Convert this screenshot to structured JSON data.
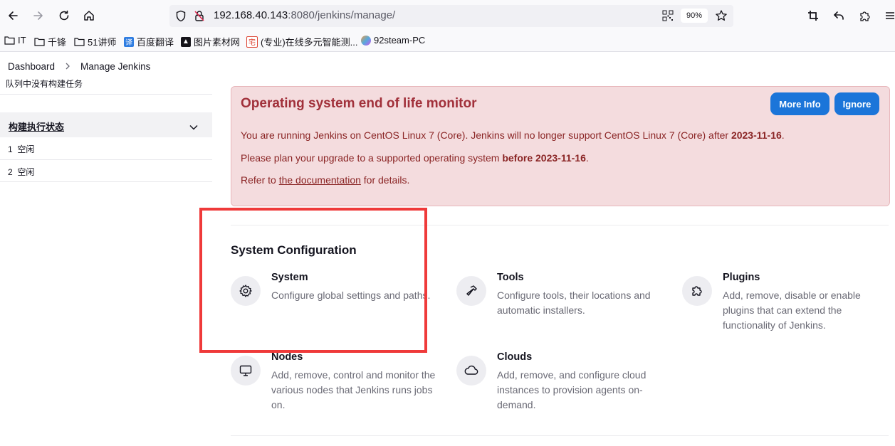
{
  "browser": {
    "url_host": "192.168.40.143",
    "url_rest": ":8080/jenkins/manage/",
    "zoom": "90%",
    "bookmarks": [
      {
        "label": "IT",
        "icon": "folder-icon"
      },
      {
        "label": "千锋",
        "icon": "folder-icon"
      },
      {
        "label": "51讲师",
        "icon": "folder-icon"
      },
      {
        "label": "百度翻译",
        "icon": "translate-icon"
      },
      {
        "label": "图片素材网",
        "icon": "image-site-icon"
      },
      {
        "label": "(专业)在线多元智能测...",
        "icon": "site-icon"
      },
      {
        "label": "92steam-PC",
        "icon": "steam-icon"
      }
    ]
  },
  "breadcrumb": {
    "items": [
      "Dashboard",
      "Manage Jenkins"
    ]
  },
  "sidebar": {
    "queue_text": "队列中没有构建任务",
    "executors_title": "构建执行状态",
    "executors": [
      {
        "num": "1",
        "status": "空闲"
      },
      {
        "num": "2",
        "status": "空闲"
      }
    ]
  },
  "alert": {
    "title": "Operating system end of life monitor",
    "more_info": "More Info",
    "ignore": "Ignore",
    "line1_pre": "You are running Jenkins on CentOS Linux 7 (Core). Jenkins will no longer support CentOS Linux 7 (Core) after ",
    "line1_date": "2023-11-16",
    "line1_post": ".",
    "line2_pre": "Please plan your upgrade to a supported operating system ",
    "line2_bold": "before 2023-11-16",
    "line2_post": ".",
    "line3_pre": "Refer to ",
    "line3_link": "the documentation",
    "line3_post": " for details."
  },
  "system_configuration": {
    "title": "System Configuration",
    "items": [
      {
        "title": "System",
        "desc": "Configure global settings and paths.",
        "icon": "gear-icon"
      },
      {
        "title": "Tools",
        "desc": "Configure tools, their locations and automatic installers.",
        "icon": "hammer-icon"
      },
      {
        "title": "Plugins",
        "desc": "Add, remove, disable or enable plugins that can extend the functionality of Jenkins.",
        "icon": "puzzle-icon"
      },
      {
        "title": "Nodes",
        "desc": "Add, remove, control and monitor the various nodes that Jenkins runs jobs on.",
        "icon": "monitor-icon"
      },
      {
        "title": "Clouds",
        "desc": "Add, remove, and configure cloud instances to provision agents on-demand.",
        "icon": "cloud-icon"
      }
    ]
  },
  "colors": {
    "alert_bg": "#f4dcde",
    "alert_text": "#8a2424",
    "button_blue": "#1b75d9",
    "highlight_red": "#ef3a3a"
  }
}
